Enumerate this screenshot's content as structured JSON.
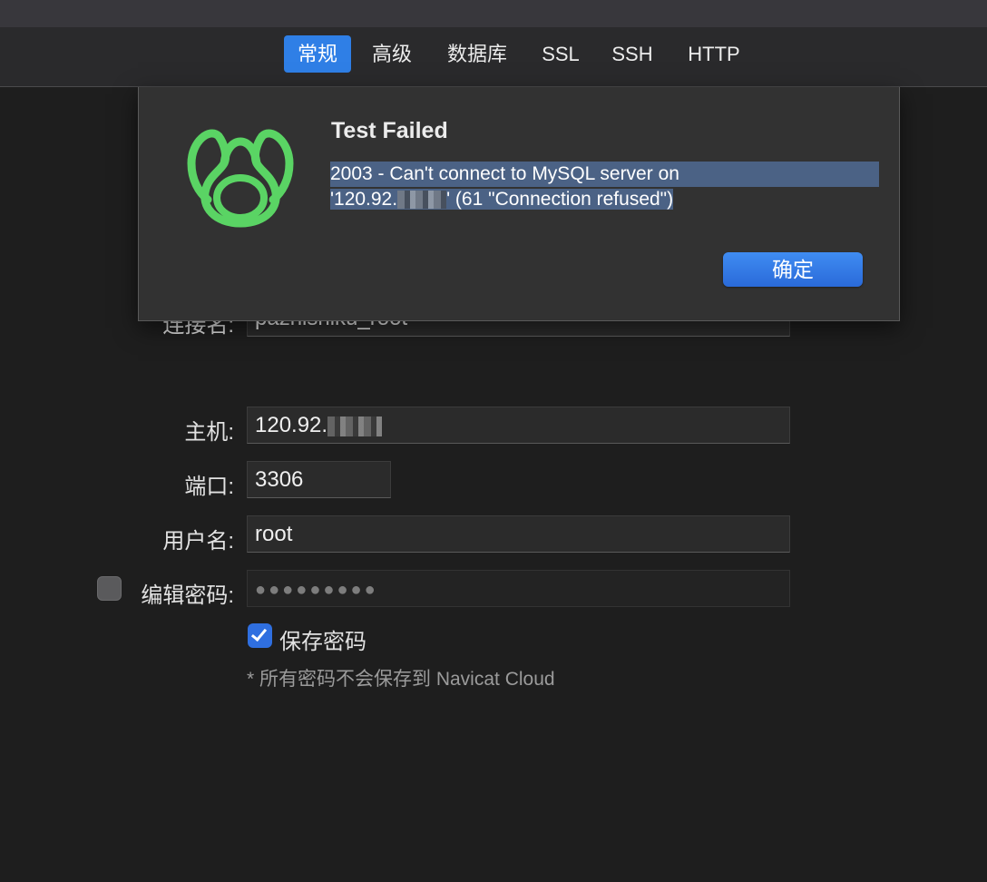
{
  "tabs": [
    {
      "label": "常规",
      "active": true
    },
    {
      "label": "高级",
      "active": false
    },
    {
      "label": "数据库",
      "active": false
    },
    {
      "label": "SSL",
      "active": false
    },
    {
      "label": "SSH",
      "active": false
    },
    {
      "label": "HTTP",
      "active": false
    }
  ],
  "form": {
    "connection_name_label": "连接名:",
    "connection_name_value": "pazhishiku_root",
    "host_label": "主机:",
    "host_value": "120.92.",
    "port_label": "端口:",
    "port_value": "3306",
    "username_label": "用户名:",
    "username_value": "root",
    "edit_password_label": "编辑密码:",
    "edit_password_checked": false,
    "password_value": "●●●●●●●●●",
    "save_password_label": "保存密码",
    "save_password_checked": true,
    "cloud_note": "* 所有密码不会保存到 Navicat Cloud"
  },
  "dialog": {
    "icon": "navicat-logo-icon",
    "title": "Test Failed",
    "message_line1": "2003 - Can't connect to MySQL server on",
    "message_line2_prefix": "'120.92.",
    "message_line2_suffix": "' (61 \"Connection refused\")",
    "ok_label": "确定"
  },
  "colors": {
    "accent": "#2f7fe6",
    "logo_green": "#5ad464",
    "background": "#1e1e1e"
  }
}
